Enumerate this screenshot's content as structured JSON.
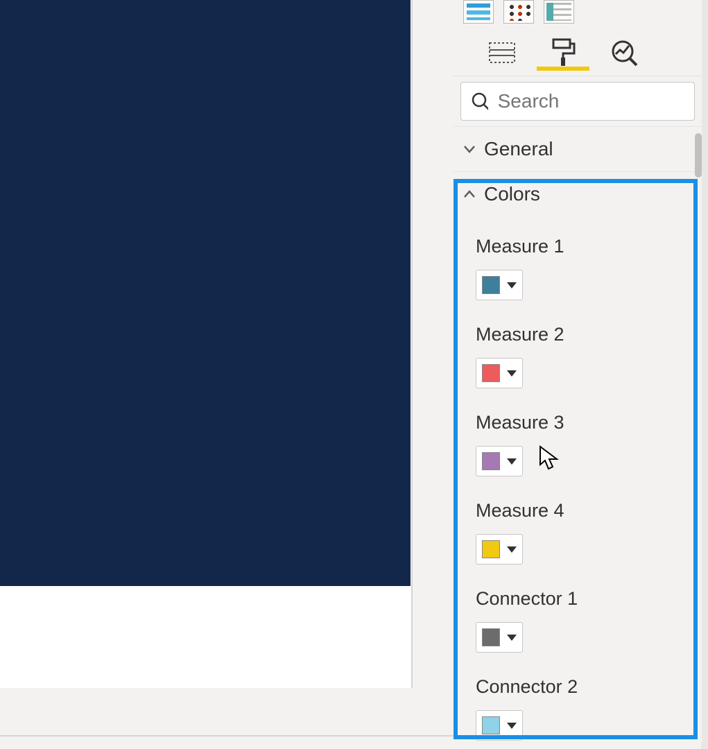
{
  "search": {
    "placeholder": "Search"
  },
  "sections": {
    "general_label": "General",
    "colors_label": "Colors"
  },
  "color_fields": {
    "m1": {
      "label": "Measure 1",
      "color": "#3e7f9b"
    },
    "m2": {
      "label": "Measure 2",
      "color": "#ee5b5b"
    },
    "m3": {
      "label": "Measure 3",
      "color": "#a678b4"
    },
    "m4": {
      "label": "Measure 4",
      "color": "#f2c811"
    },
    "c1": {
      "label": "Connector 1",
      "color": "#6c6c6c"
    },
    "c2": {
      "label": "Connector 2",
      "color": "#8fd3e8"
    }
  }
}
